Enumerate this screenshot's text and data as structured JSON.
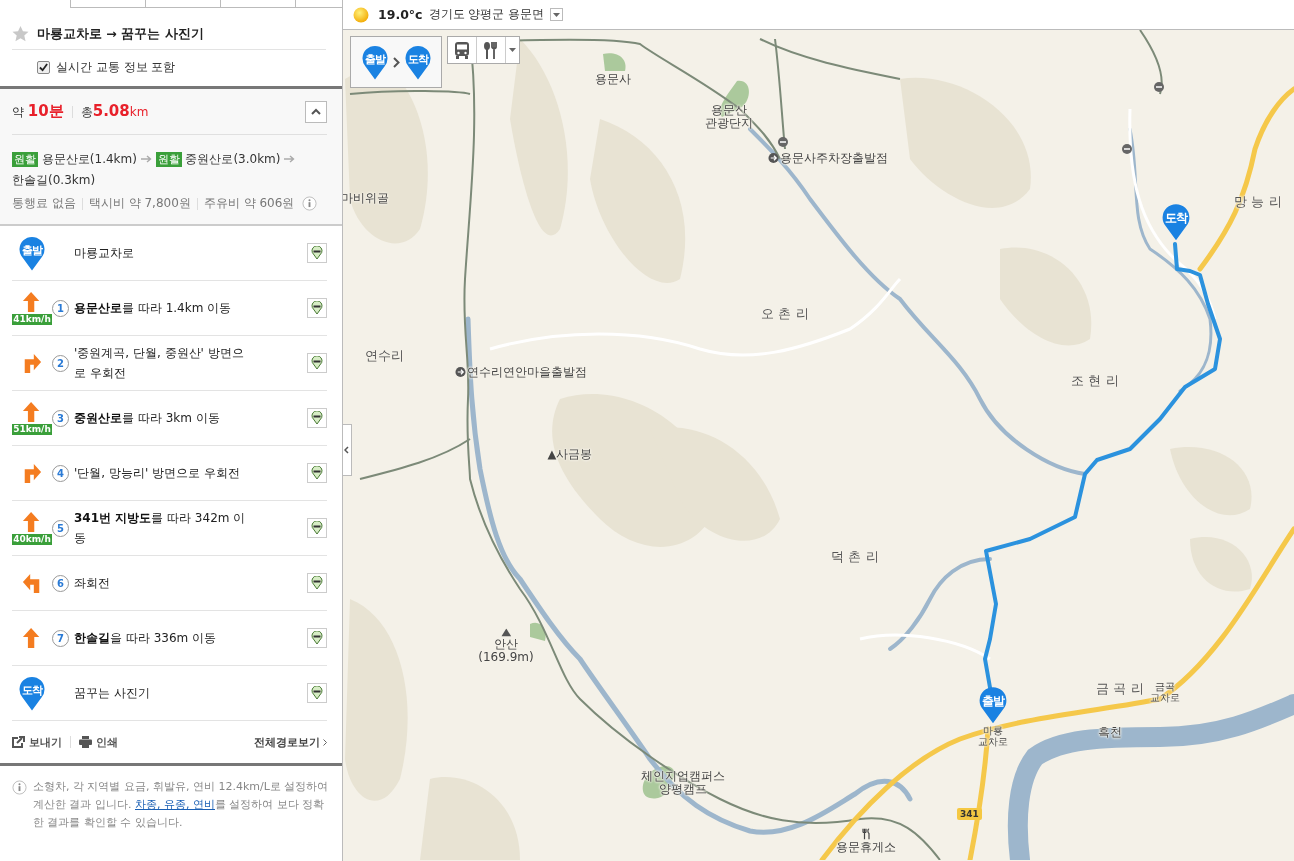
{
  "route_header": {
    "starred": false,
    "title": "마룡교차로 → 꿈꾸는 사진기"
  },
  "realtime_traffic": {
    "label": "실시간 교통 정보 포함",
    "checked": true
  },
  "summary": {
    "duration_prefix": "약",
    "duration": "10분",
    "distance_prefix": "총",
    "distance": "5.08",
    "distance_unit": "km",
    "expanded": true
  },
  "route_roads": [
    {
      "traffic": "원활",
      "road": "용문산로(1.4km)"
    },
    {
      "traffic": "원활",
      "road": "중원산로(3.0km)"
    },
    {
      "road": "한솔길(0.3km)"
    }
  ],
  "costs": [
    "통행료 없음",
    "택시비 약 7,800원",
    "주유비 약 606원"
  ],
  "steps": [
    {
      "kind": "start",
      "pin": "출발",
      "text": "마룡교차로"
    },
    {
      "kind": "straight",
      "number": "1",
      "speed": "41km/h",
      "text": "**용문산로**를 따라 1.4km 이동"
    },
    {
      "kind": "right",
      "number": "2",
      "text": "'중원계곡, 단월, 중원산' 방면으로 우회전"
    },
    {
      "kind": "straight",
      "number": "3",
      "speed": "51km/h",
      "text": "**중원산로**를 따라 3km 이동"
    },
    {
      "kind": "right",
      "number": "4",
      "text": "'단월, 망능리' 방면으로 우회전"
    },
    {
      "kind": "straight",
      "number": "5",
      "speed": "40km/h",
      "text": "**341번 지방도**를 따라 342m 이동"
    },
    {
      "kind": "left",
      "number": "6",
      "text": "좌회전"
    },
    {
      "kind": "straight",
      "number": "7",
      "text": "**한솔길**을 따라 336m 이동"
    },
    {
      "kind": "end",
      "pin": "도착",
      "text": "꿈꾸는 사진기"
    }
  ],
  "actions": [
    "보내기",
    "인쇄"
  ],
  "full_route_link": "전체경로보기",
  "note": {
    "before": "소형차, 각 지역별 요금, 휘발유, 연비 12.4km/L로 설정하여 계산한 결과 입니다. ",
    "link": "차종, 유종, 연비",
    "after": "를 설정하여 보다 정확한 결과를 확인할 수 있습니다."
  },
  "weather": {
    "temperature": "19.0°c",
    "location": "경기도 양평군 용문면"
  },
  "map_toolbar": {
    "start_pin": "출발",
    "end_pin": "도착"
  },
  "map_labels": [
    {
      "text": "용문사",
      "kind": "poi"
    },
    {
      "text": "용문산 관광단지",
      "kind": "poi"
    },
    {
      "text": "용문사주차장출발점",
      "kind": "bus"
    },
    {
      "text": "망 능 리",
      "kind": "village"
    },
    {
      "text": "마비위골",
      "kind": "poi"
    },
    {
      "text": "오 촌 리",
      "kind": "village"
    },
    {
      "text": "연수리",
      "kind": "village"
    },
    {
      "text": "연수리연안마을출발점",
      "kind": "bus"
    },
    {
      "text": "조 현 리",
      "kind": "village"
    },
    {
      "text": "▲사금봉",
      "kind": "poi"
    },
    {
      "text": "덕 촌 리",
      "kind": "village"
    },
    {
      "text": "안산 (169.9m)",
      "kind": "mountain"
    },
    {
      "text": "금 곡 리",
      "kind": "village"
    },
    {
      "text": "금곡 교차로",
      "kind": "junction"
    },
    {
      "text": "마룡 교차로",
      "kind": "junction"
    },
    {
      "text": "흑천",
      "kind": "stream"
    },
    {
      "text": "체인지업캠퍼스 양평캠프",
      "kind": "poi"
    },
    {
      "text": "용문휴게소",
      "kind": "rest"
    }
  ],
  "map_pins": [
    {
      "label": "도착"
    },
    {
      "label": "출발"
    }
  ],
  "road_shield": "341"
}
